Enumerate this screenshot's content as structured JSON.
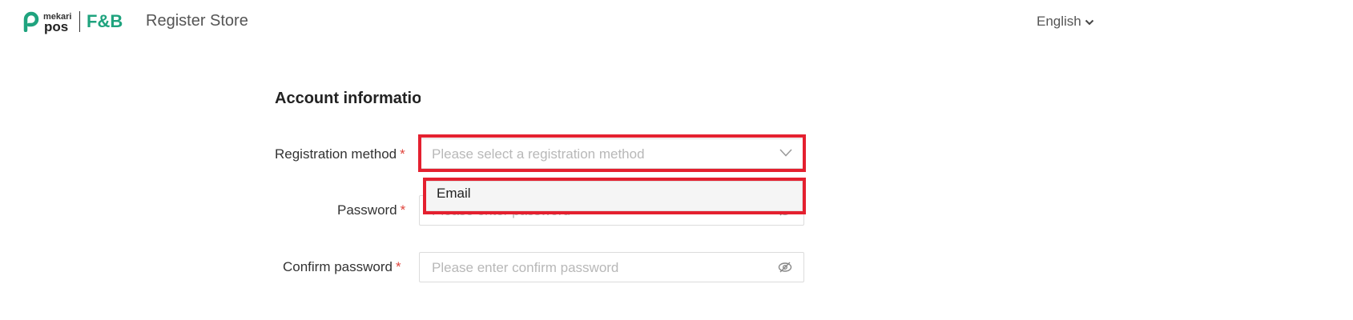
{
  "header": {
    "brand_small": "mekari",
    "brand_main": "pos",
    "product": "F&B",
    "title": "Register Store",
    "language": "English"
  },
  "form": {
    "section_title": "Account information",
    "fields": [
      {
        "label": "Registration method",
        "placeholder": "Please select a registration method",
        "required": "*",
        "icon": "chevron-down-icon"
      },
      {
        "label": "Password",
        "placeholder": "Please enter password",
        "required": "*",
        "icon": "eye-off-icon"
      },
      {
        "label": "Confirm password",
        "placeholder": "Please enter confirm password",
        "required": "*",
        "icon": "eye-off-icon"
      }
    ],
    "dropdown_options": [
      "Email"
    ]
  },
  "colors": {
    "brand_green": "#1fa37e",
    "highlight_red": "#e4202f",
    "required_red": "#e0453d"
  }
}
